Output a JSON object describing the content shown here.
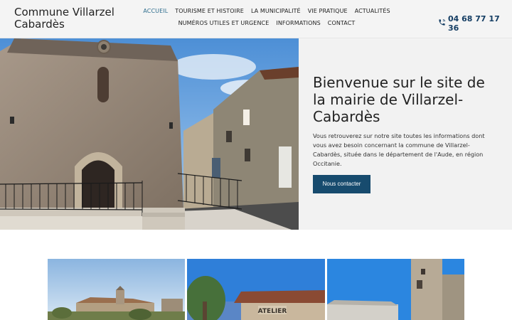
{
  "header": {
    "brand_line1": "Commune Villarzel",
    "brand_line2": "Cabardès",
    "phone": "04 68 77 17 36",
    "phone_icon": "phone-icon"
  },
  "nav": {
    "row1": [
      "ACCUEIL",
      "TOURISME ET HISTOIRE",
      "LA MUNICIPALITÉ",
      "VIE PRATIQUE",
      "ACTUALITÉS"
    ],
    "row2": [
      "NUMÉROS UTILES ET URGENCE",
      "INFORMATIONS",
      "CONTACT"
    ],
    "active": "ACCUEIL"
  },
  "hero": {
    "title": "Bienvenue sur le site de la mairie de Villarzel-Cabardès",
    "text": "Vous retrouverez sur notre site toutes les informations dont vous avez besoin concernant la commune de Villarzel-Cabardès, située dans le département de l'Aude, en région Occitanie.",
    "button": "Nous contacter"
  },
  "gallery": {
    "sign_text": "ATELIER"
  },
  "colors": {
    "accent": "#174b6e",
    "active_nav": "#2f6e8e",
    "phone": "#143d63"
  }
}
